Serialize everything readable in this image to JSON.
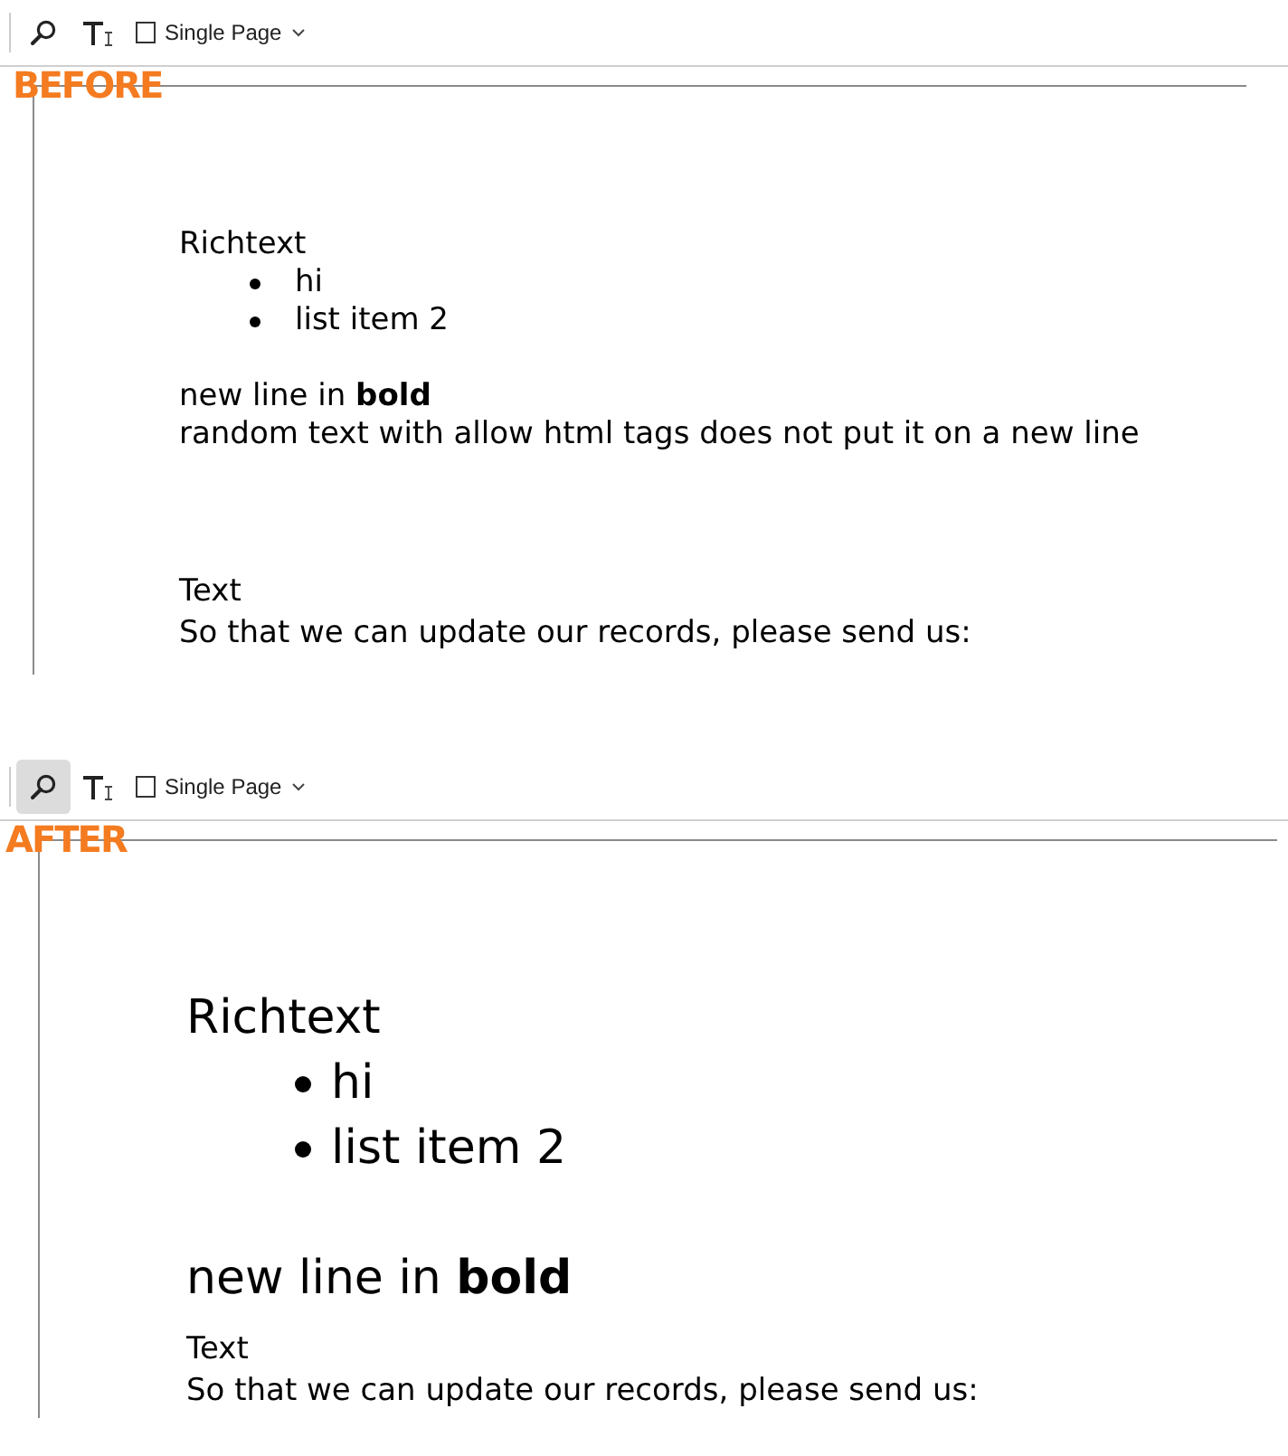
{
  "panels": [
    {
      "label": "BEFORE",
      "kind": "normal",
      "toolbar": {
        "search_selected": false,
        "view_mode": "Single Page"
      },
      "richtext": {
        "title": "Richtext",
        "items": [
          "hi",
          "list item 2"
        ],
        "lines": [
          "new line in **bold**",
          "random text with allow html tags does not put it on a new line"
        ]
      },
      "text": {
        "title": "Text",
        "body": "So that we can update our records, please send us:"
      }
    },
    {
      "label": "AFTER",
      "kind": "large",
      "toolbar": {
        "search_selected": true,
        "view_mode": "Single Page"
      },
      "richtext": {
        "title": "Richtext",
        "items": [
          "hi",
          "list item 2"
        ],
        "lines": [
          "new line in **bold**"
        ]
      },
      "text": {
        "title": "Text",
        "body": "So that we can update our records, please send us:"
      }
    }
  ]
}
